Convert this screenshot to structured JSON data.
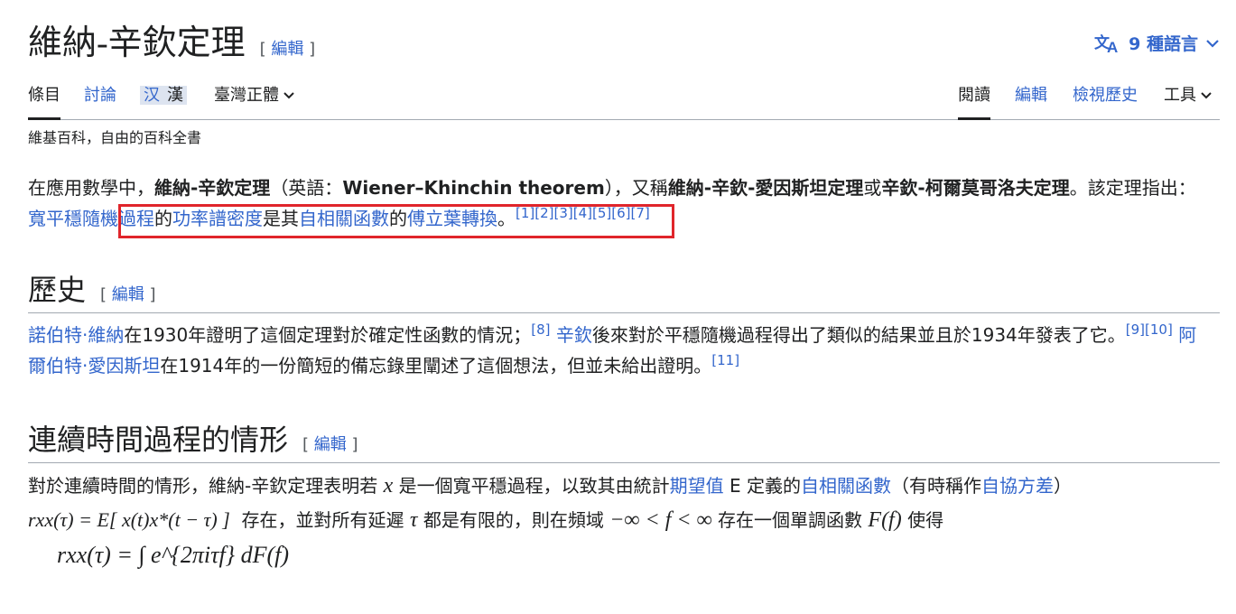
{
  "title": "維納-辛欽定理",
  "edit_labels": {
    "open": "[",
    "text": "編輯",
    "close": "]"
  },
  "lang_button": {
    "label": "9 種語言"
  },
  "tabs_left": {
    "article": "條目",
    "talk": "討論",
    "variant_1": "汉",
    "variant_2": "漢",
    "variant_menu": "臺灣正體"
  },
  "tabs_right": {
    "read": "閱讀",
    "edit": "編輯",
    "history": "檢視歷史",
    "tools": "工具"
  },
  "tagline": "維基百科，自由的百科全書",
  "intro": {
    "t1": "在應用數學中，",
    "b1": "維納-辛欽定理",
    "t2": "（英語：",
    "b2": "Wiener–Khinchin theorem",
    "t3": "），又稱",
    "b3": "維納-辛欽-愛因斯坦定理",
    "t4": "或",
    "b4": "辛欽-柯爾莫哥洛夫定理",
    "t5": "。該定理指出：",
    "l1": "寬平穩隨機過程",
    "t6": "的",
    "l2": "功率譜密度",
    "t7": "是其",
    "l3": "自相關函數",
    "t8": "的",
    "l4": "傅立葉轉換",
    "t9": "。",
    "refs": "[1][2][3][4][5][6][7]"
  },
  "history": {
    "heading": "歷史",
    "l1": "諾伯特·維納",
    "t1": "在1930年證明了這個定理對於確定性函數的情況；",
    "r1": "[8]",
    "l2": "辛欽",
    "t2": "後來對於平穩隨機過程得出了類似的結果並且於1934年發表了它。",
    "r2": "[9][10]",
    "l3": "阿爾伯特·愛因斯坦",
    "t3": "在1914年的一份簡短的備忘錄里闡述了這個想法，但並未給出證明。",
    "r3": "[11]"
  },
  "continuous": {
    "heading": "連續時間過程的情形",
    "t1": "對於連續時間的情形，維納-辛欽定理表明若",
    "m_x": "x",
    "t2": "是一個寬平穩過程，以致其由統計",
    "l1": "期望值",
    "t3": "E 定義的",
    "l2": "自相關函數",
    "t4": "（有時稱作",
    "l3": "自協方差",
    "t5": "）",
    "eq1": "rxx(τ) = E[ x(t)x*(t − τ) ]",
    "t6": "存在，並對所有延遲",
    "m_tau": "τ",
    "t7": "都是有限的，則在頻域",
    "m_range": "−∞ < f < ∞",
    "t8": "存在一個單調函數",
    "m_F": "F(f)",
    "t9": "使得",
    "formula": "rxx(τ) = ∫ e^{2πiτf} dF(f)"
  }
}
